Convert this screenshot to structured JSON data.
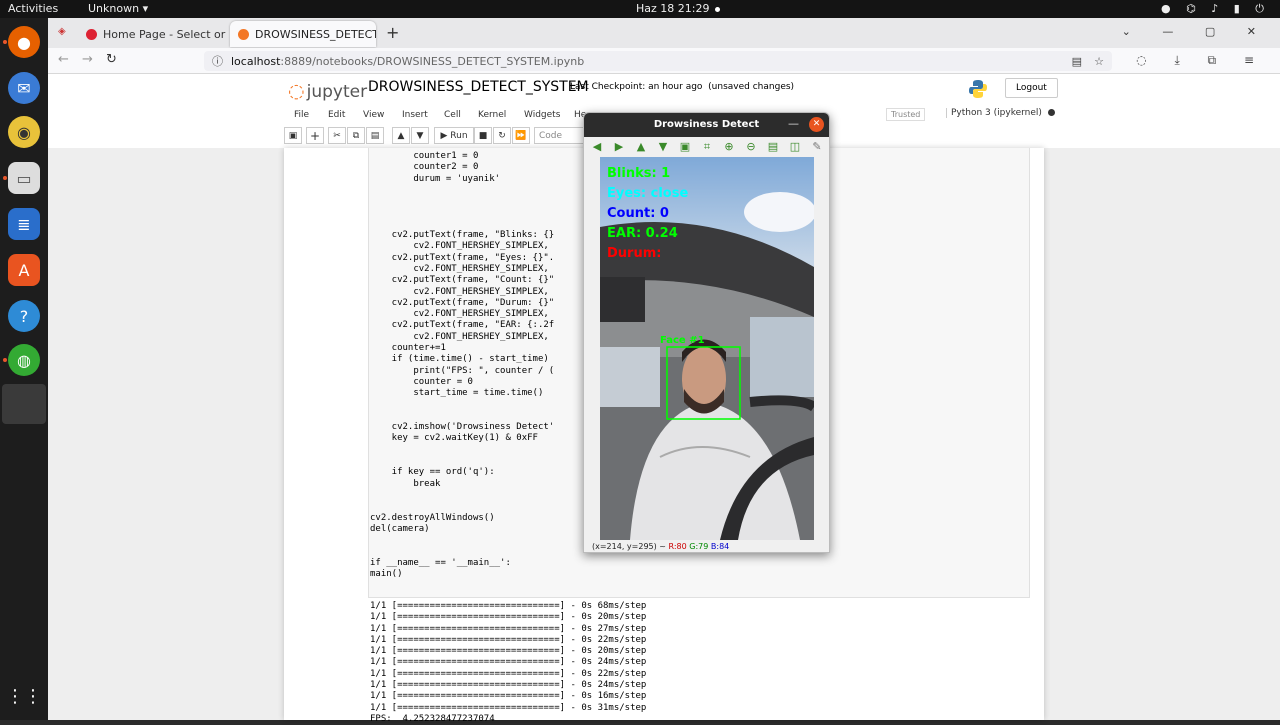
{
  "topbar": {
    "activities": "Activities",
    "app_menu": "Unknown",
    "clock": "Haz 18  21:29"
  },
  "browser": {
    "tabs": [
      {
        "label": "Home Page - Select or cr",
        "active": false
      },
      {
        "label": "DROWSINESS_DETECT_S",
        "active": true
      }
    ],
    "url_host": "localhost",
    "url_path": ":8889/notebooks/DROWSINESS_DETECT_SYSTEM.ipynb"
  },
  "jupyter": {
    "logo": "jupyter",
    "notebook_name": "DROWSINESS_DETECT_SYSTEM",
    "checkpoint": "Last Checkpoint: an hour ago",
    "unsaved": "(unsaved changes)",
    "logout": "Logout",
    "menu": [
      "File",
      "Edit",
      "View",
      "Insert",
      "Cell",
      "Kernel",
      "Widgets",
      "He"
    ],
    "trusted": "Trusted",
    "kernel": "Python 3 (ipykernel)",
    "toolbar": {
      "run": "Run",
      "cell_type": "Code"
    }
  },
  "code_lines": [
    "        counter1 = 0",
    "        counter2 = 0",
    "        durum = 'uyanik'",
    "",
    "",
    "",
    "",
    "    cv2.putText(frame, \"Blinks: {}",
    "        cv2.FONT_HERSHEY_SIMPLEX,",
    "    cv2.putText(frame, \"Eyes: {}\".",
    "        cv2.FONT_HERSHEY_SIMPLEX,",
    "    cv2.putText(frame, \"Count: {}\"",
    "        cv2.FONT_HERSHEY_SIMPLEX,",
    "    cv2.putText(frame, \"Durum: {}\"",
    "        cv2.FONT_HERSHEY_SIMPLEX,",
    "    cv2.putText(frame, \"EAR: {:.2f",
    "        cv2.FONT_HERSHEY_SIMPLEX,",
    "    counter+=1",
    "    if (time.time() - start_time)",
    "        print(\"FPS: \", counter / (",
    "        counter = 0",
    "        start_time = time.time()",
    "",
    "",
    "    cv2.imshow('Drowsiness Detect'",
    "    key = cv2.waitKey(1) & 0xFF",
    "",
    "",
    "    if key == ord('q'):",
    "        break",
    "",
    "",
    "cv2.destroyAllWindows()",
    "del(camera)",
    "",
    "",
    "if __name__ == '__main__':",
    "main()"
  ],
  "output_lines": [
    "1/1 [==============================] - 0s 68ms/step",
    "1/1 [==============================] - 0s 20ms/step",
    "1/1 [==============================] - 0s 27ms/step",
    "1/1 [==============================] - 0s 22ms/step",
    "1/1 [==============================] - 0s 20ms/step",
    "1/1 [==============================] - 0s 24ms/step",
    "1/1 [==============================] - 0s 22ms/step",
    "1/1 [==============================] - 0s 24ms/step",
    "1/1 [==============================] - 0s 16ms/step",
    "1/1 [==============================] - 0s 31ms/step",
    "FPS:  4.252328477237074"
  ],
  "cv_window": {
    "title": "Drowsiness Detect",
    "overlay": {
      "blinks": "Blinks: 1",
      "eyes": "Eyes: close",
      "count": "Count: 0",
      "ear": "EAR: 0.24",
      "durum": "Durum:",
      "face": "Face #1"
    },
    "status_prefix": "(x=214, y=295) ~",
    "status_r": "R:80",
    "status_g": "G:79",
    "status_b": "B:84"
  },
  "colors": {
    "jupyter_orange": "#f37726",
    "ubuntu_orange": "#e95420",
    "overlay_green": "#00ff00",
    "overlay_cyan": "#00ffff",
    "overlay_blue": "#0000ff",
    "overlay_red": "#ff0000"
  }
}
